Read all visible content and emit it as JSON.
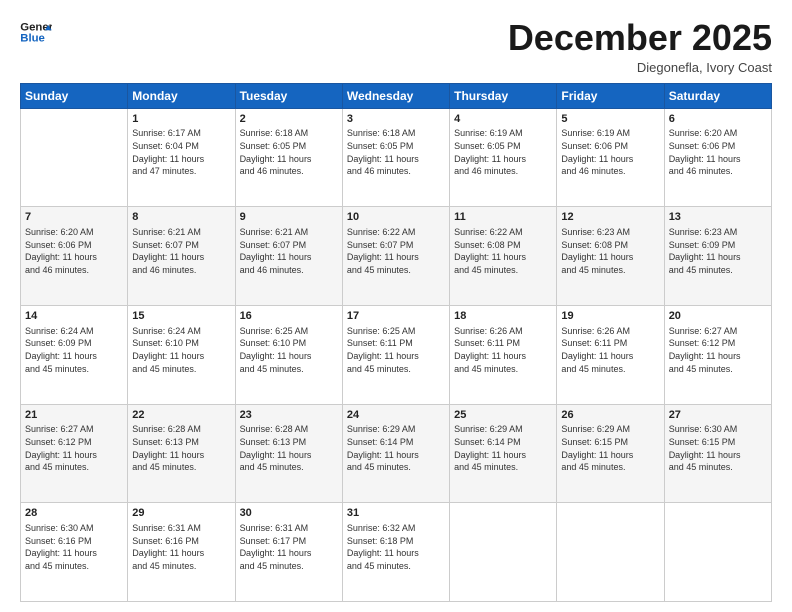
{
  "header": {
    "logo_line1": "General",
    "logo_line2": "Blue",
    "month": "December 2025",
    "location": "Diegonefla, Ivory Coast"
  },
  "days_of_week": [
    "Sunday",
    "Monday",
    "Tuesday",
    "Wednesday",
    "Thursday",
    "Friday",
    "Saturday"
  ],
  "weeks": [
    [
      {
        "day": "",
        "info": ""
      },
      {
        "day": "1",
        "info": "Sunrise: 6:17 AM\nSunset: 6:04 PM\nDaylight: 11 hours\nand 47 minutes."
      },
      {
        "day": "2",
        "info": "Sunrise: 6:18 AM\nSunset: 6:05 PM\nDaylight: 11 hours\nand 46 minutes."
      },
      {
        "day": "3",
        "info": "Sunrise: 6:18 AM\nSunset: 6:05 PM\nDaylight: 11 hours\nand 46 minutes."
      },
      {
        "day": "4",
        "info": "Sunrise: 6:19 AM\nSunset: 6:05 PM\nDaylight: 11 hours\nand 46 minutes."
      },
      {
        "day": "5",
        "info": "Sunrise: 6:19 AM\nSunset: 6:06 PM\nDaylight: 11 hours\nand 46 minutes."
      },
      {
        "day": "6",
        "info": "Sunrise: 6:20 AM\nSunset: 6:06 PM\nDaylight: 11 hours\nand 46 minutes."
      }
    ],
    [
      {
        "day": "7",
        "info": "Sunrise: 6:20 AM\nSunset: 6:06 PM\nDaylight: 11 hours\nand 46 minutes."
      },
      {
        "day": "8",
        "info": "Sunrise: 6:21 AM\nSunset: 6:07 PM\nDaylight: 11 hours\nand 46 minutes."
      },
      {
        "day": "9",
        "info": "Sunrise: 6:21 AM\nSunset: 6:07 PM\nDaylight: 11 hours\nand 46 minutes."
      },
      {
        "day": "10",
        "info": "Sunrise: 6:22 AM\nSunset: 6:07 PM\nDaylight: 11 hours\nand 45 minutes."
      },
      {
        "day": "11",
        "info": "Sunrise: 6:22 AM\nSunset: 6:08 PM\nDaylight: 11 hours\nand 45 minutes."
      },
      {
        "day": "12",
        "info": "Sunrise: 6:23 AM\nSunset: 6:08 PM\nDaylight: 11 hours\nand 45 minutes."
      },
      {
        "day": "13",
        "info": "Sunrise: 6:23 AM\nSunset: 6:09 PM\nDaylight: 11 hours\nand 45 minutes."
      }
    ],
    [
      {
        "day": "14",
        "info": "Sunrise: 6:24 AM\nSunset: 6:09 PM\nDaylight: 11 hours\nand 45 minutes."
      },
      {
        "day": "15",
        "info": "Sunrise: 6:24 AM\nSunset: 6:10 PM\nDaylight: 11 hours\nand 45 minutes."
      },
      {
        "day": "16",
        "info": "Sunrise: 6:25 AM\nSunset: 6:10 PM\nDaylight: 11 hours\nand 45 minutes."
      },
      {
        "day": "17",
        "info": "Sunrise: 6:25 AM\nSunset: 6:11 PM\nDaylight: 11 hours\nand 45 minutes."
      },
      {
        "day": "18",
        "info": "Sunrise: 6:26 AM\nSunset: 6:11 PM\nDaylight: 11 hours\nand 45 minutes."
      },
      {
        "day": "19",
        "info": "Sunrise: 6:26 AM\nSunset: 6:11 PM\nDaylight: 11 hours\nand 45 minutes."
      },
      {
        "day": "20",
        "info": "Sunrise: 6:27 AM\nSunset: 6:12 PM\nDaylight: 11 hours\nand 45 minutes."
      }
    ],
    [
      {
        "day": "21",
        "info": "Sunrise: 6:27 AM\nSunset: 6:12 PM\nDaylight: 11 hours\nand 45 minutes."
      },
      {
        "day": "22",
        "info": "Sunrise: 6:28 AM\nSunset: 6:13 PM\nDaylight: 11 hours\nand 45 minutes."
      },
      {
        "day": "23",
        "info": "Sunrise: 6:28 AM\nSunset: 6:13 PM\nDaylight: 11 hours\nand 45 minutes."
      },
      {
        "day": "24",
        "info": "Sunrise: 6:29 AM\nSunset: 6:14 PM\nDaylight: 11 hours\nand 45 minutes."
      },
      {
        "day": "25",
        "info": "Sunrise: 6:29 AM\nSunset: 6:14 PM\nDaylight: 11 hours\nand 45 minutes."
      },
      {
        "day": "26",
        "info": "Sunrise: 6:29 AM\nSunset: 6:15 PM\nDaylight: 11 hours\nand 45 minutes."
      },
      {
        "day": "27",
        "info": "Sunrise: 6:30 AM\nSunset: 6:15 PM\nDaylight: 11 hours\nand 45 minutes."
      }
    ],
    [
      {
        "day": "28",
        "info": "Sunrise: 6:30 AM\nSunset: 6:16 PM\nDaylight: 11 hours\nand 45 minutes."
      },
      {
        "day": "29",
        "info": "Sunrise: 6:31 AM\nSunset: 6:16 PM\nDaylight: 11 hours\nand 45 minutes."
      },
      {
        "day": "30",
        "info": "Sunrise: 6:31 AM\nSunset: 6:17 PM\nDaylight: 11 hours\nand 45 minutes."
      },
      {
        "day": "31",
        "info": "Sunrise: 6:32 AM\nSunset: 6:18 PM\nDaylight: 11 hours\nand 45 minutes."
      },
      {
        "day": "",
        "info": ""
      },
      {
        "day": "",
        "info": ""
      },
      {
        "day": "",
        "info": ""
      }
    ]
  ]
}
